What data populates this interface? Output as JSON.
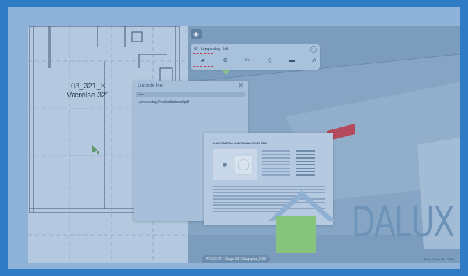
{
  "floor_plan": {
    "room_id": "03_321_K",
    "room_name": "Værelse 321"
  },
  "viewport": {
    "view_button_icon": "camera-icon"
  },
  "object_toolbar": {
    "title": "03 - Lampeudtag - loft",
    "close_icon": "circle-close-icon",
    "buttons": [
      {
        "name": "folder-icon",
        "glyph": "▰",
        "active": true
      },
      {
        "name": "hide-icon",
        "glyph": "⊘",
        "active": false
      },
      {
        "name": "scissors-icon",
        "glyph": "✂",
        "active": false
      },
      {
        "name": "tag-icon",
        "glyph": "◇",
        "active": false
      },
      {
        "name": "measure-icon",
        "glyph": "▬",
        "active": false
      },
      {
        "name": "text-icon",
        "glyph": "A",
        "active": false
      }
    ]
  },
  "linked_files": {
    "title": "Linkede filer",
    "close": "✕",
    "column_header": "Navn",
    "files": [
      "Lampeudtag,Produktdatablad.pdf"
    ]
  },
  "product_sheet": {
    "title": "LAMPEUDTAG UNIVERSAL HEKBE 8100"
  },
  "logo": {
    "text": "DALUX",
    "house_color": "#86c47e"
  },
  "breadcrumb": {
    "text": "PROJEKT › Etage 03 › Etageplan_E03"
  },
  "scale_note": "Dalux Viewer 3D · 1:100",
  "colors": {
    "border": "#2f7cc4",
    "accent_red": "#c0394b"
  }
}
